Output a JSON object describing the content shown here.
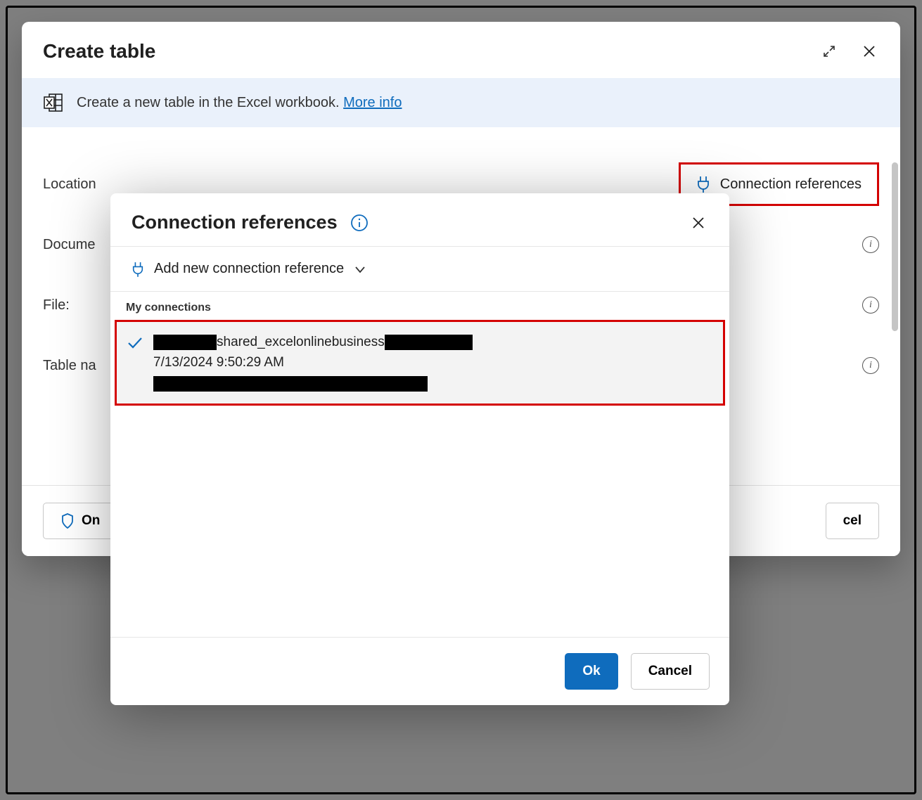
{
  "main": {
    "title": "Create table",
    "info_text": "Create a new table in the Excel workbook.",
    "more_info": "More info",
    "fields": {
      "location": "Location",
      "document": "Docume",
      "file": "File:",
      "table_name": "Table na"
    },
    "conn_trigger": "Connection references",
    "footer_left": "On",
    "footer_cancel": "cel"
  },
  "popover": {
    "title": "Connection references",
    "add_new": "Add new connection reference",
    "list_header": "My connections",
    "item": {
      "name_mid": "shared_excelonlinebusiness",
      "timestamp": "7/13/2024 9:50:29 AM"
    },
    "ok": "Ok",
    "cancel": "Cancel"
  }
}
